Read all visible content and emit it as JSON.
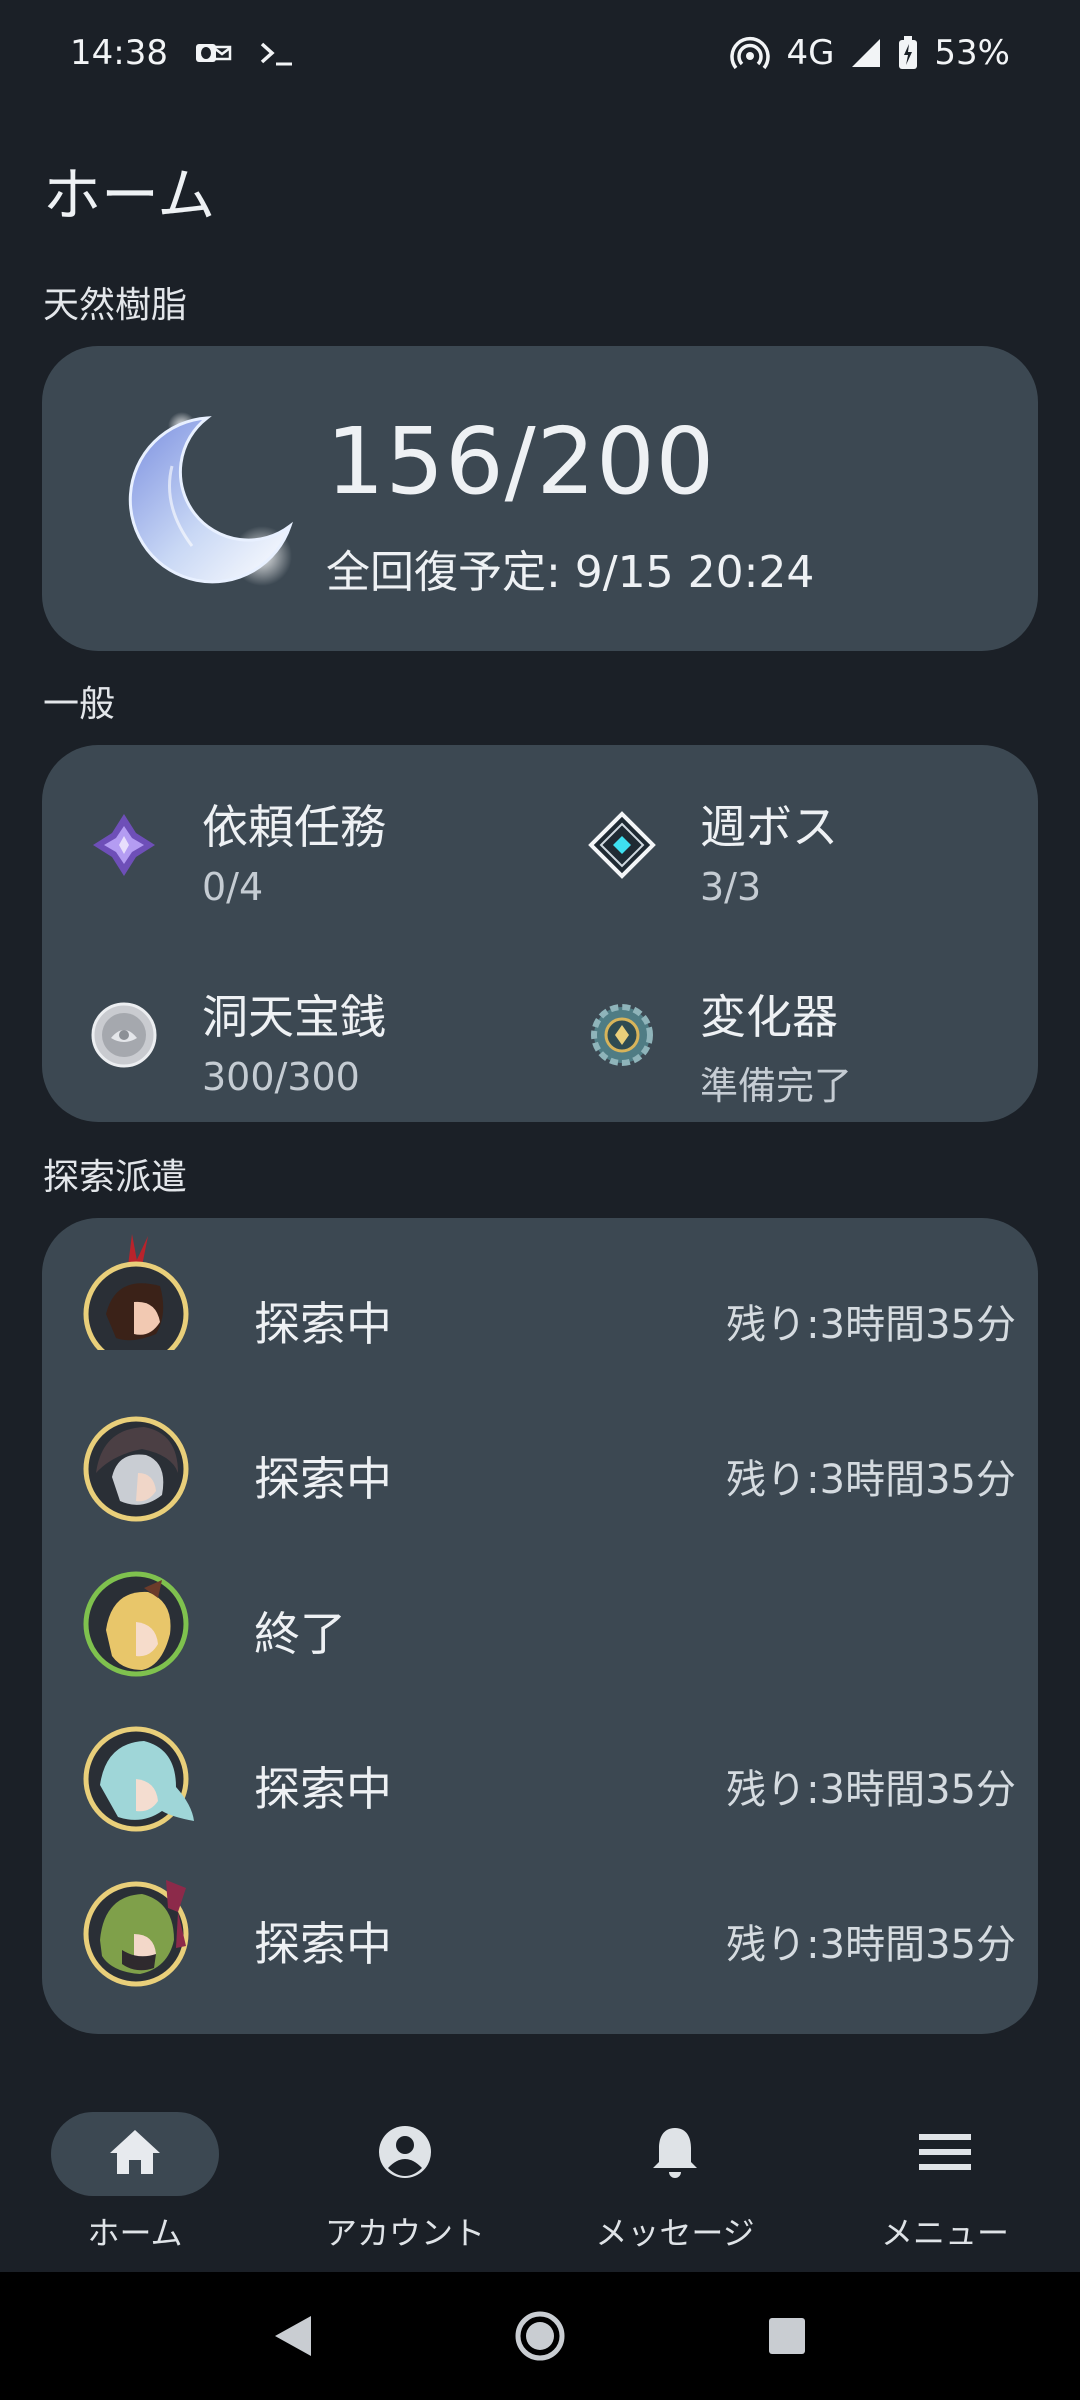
{
  "status_bar": {
    "time": "14:38",
    "network": "4G",
    "battery": "53%"
  },
  "page": {
    "title": "ホーム"
  },
  "resin": {
    "section_label": "天然樹脂",
    "value": "156/200",
    "full_recovery": "全回復予定: 9/15 20:24"
  },
  "general": {
    "section_label": "一般",
    "items": [
      {
        "title": "依頼任務",
        "value": "0/4",
        "icon": "commission-icon"
      },
      {
        "title": "週ボス",
        "value": "3/3",
        "icon": "weekly-boss-icon"
      },
      {
        "title": "洞天宝銭",
        "value": "300/300",
        "icon": "realm-currency-icon"
      },
      {
        "title": "変化器",
        "value": "準備完了",
        "icon": "transformer-icon"
      }
    ]
  },
  "expeditions": {
    "section_label": "探索派遣",
    "rows": [
      {
        "status": "探索中",
        "remaining": "残り:3時間35分",
        "ring": "#e9cf7a"
      },
      {
        "status": "探索中",
        "remaining": "残り:3時間35分",
        "ring": "#e9cf7a"
      },
      {
        "status": "終了",
        "remaining": "",
        "ring": "#7fc14e"
      },
      {
        "status": "探索中",
        "remaining": "残り:3時間35分",
        "ring": "#e9cf7a"
      },
      {
        "status": "探索中",
        "remaining": "残り:3時間35分",
        "ring": "#e9cf7a"
      }
    ]
  },
  "bottom_nav": {
    "items": [
      {
        "label": "ホーム",
        "icon": "home-icon",
        "active": true
      },
      {
        "label": "アカウント",
        "icon": "account-icon",
        "active": false
      },
      {
        "label": "メッセージ",
        "icon": "bell-icon",
        "active": false
      },
      {
        "label": "メニュー",
        "icon": "menu-icon",
        "active": false
      }
    ]
  },
  "colors": {
    "background": "#1b2027",
    "card": "#3c4852",
    "text": "#eef1f4"
  }
}
